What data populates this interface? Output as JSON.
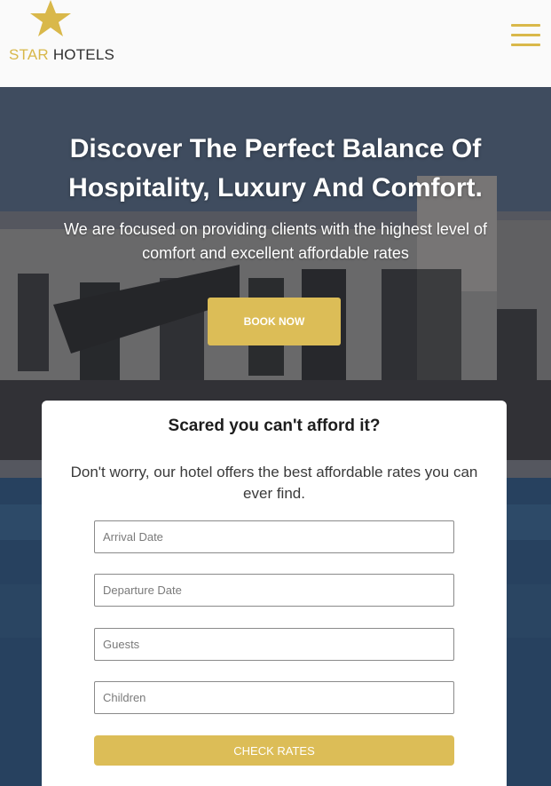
{
  "brand": {
    "logo_word_1": "STAR",
    "logo_word_2": "HOTELS",
    "logo_icon": "star-icon",
    "accent_color": "#dcbd57"
  },
  "header": {
    "menu_icon": "hamburger-menu-icon"
  },
  "hero": {
    "title": "Discover The Perfect Balance Of Hospitality, Luxury And Comfort.",
    "subtitle": "We are focused on providing clients with the highest level of comfort and excellent affordable rates",
    "cta_label": "BOOK NOW"
  },
  "booking_card": {
    "title": "Scared you can't afford it?",
    "text": "Don't worry, our hotel offers the best affordable rates you can ever find.",
    "fields": {
      "arrival_placeholder": "Arrival Date",
      "departure_placeholder": "Departure Date",
      "guests_placeholder": "Guests",
      "children_placeholder": "Children"
    },
    "submit_label": "CHECK RATES"
  }
}
